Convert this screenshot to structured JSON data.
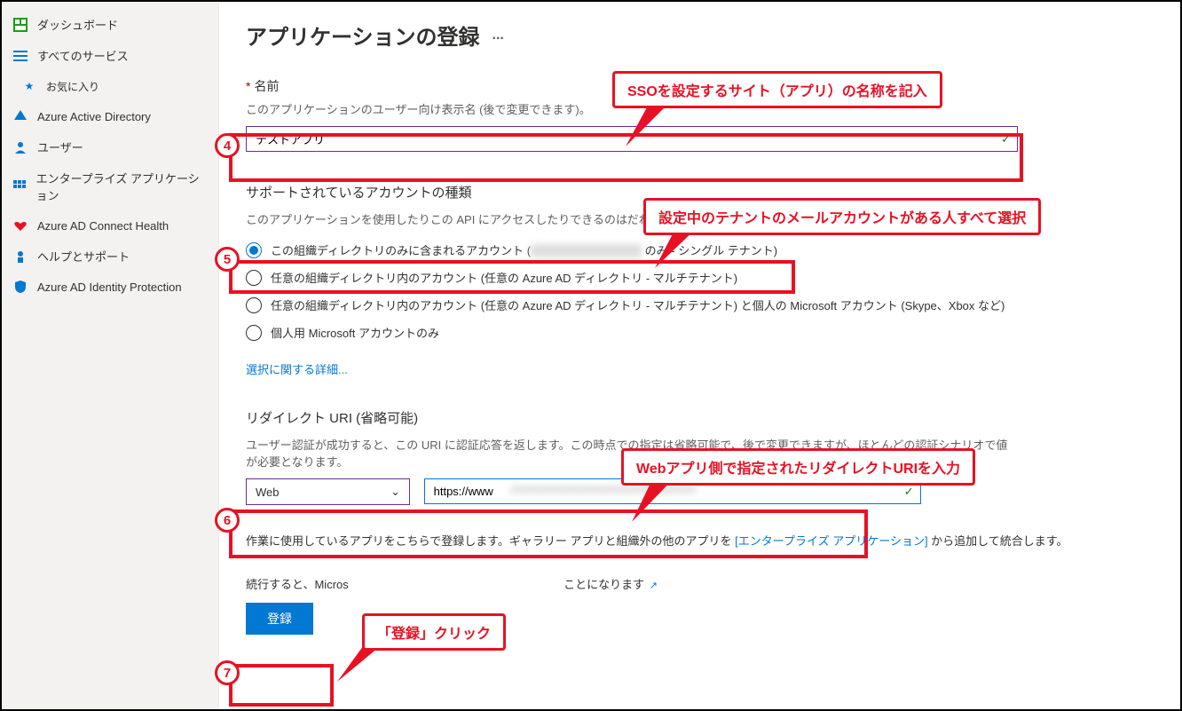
{
  "sidebar": {
    "items": [
      {
        "label": "ダッシュボード"
      },
      {
        "label": "すべてのサービス"
      },
      {
        "label": "お気に入り"
      },
      {
        "label": "Azure Active Directory"
      },
      {
        "label": "ユーザー"
      },
      {
        "label": "エンタープライズ アプリケーション"
      },
      {
        "label": "Azure AD Connect Health"
      },
      {
        "label": "ヘルプとサポート"
      },
      {
        "label": "Azure AD Identity Protection"
      }
    ]
  },
  "page": {
    "title": "アプリケーションの登録",
    "ellipsis": "..."
  },
  "nameSection": {
    "label": "名前",
    "desc": "このアプリケーションのユーザー向け表示名 (後で変更できます)。",
    "value": "テストアプリ"
  },
  "accountSection": {
    "label": "サポートされているアカウントの種類",
    "desc": "このアプリケーションを使用したりこの API にアクセスしたりできるのはだれですか?",
    "options": [
      "この組織ディレクトリのみに含まれるアカウント (",
      "任意の組織ディレクトリ内のアカウント (任意の Azure AD ディレクトリ - マルチテナント)",
      "任意の組織ディレクトリ内のアカウント (任意の Azure AD ディレクトリ - マルチテナント) と個人の Microsoft アカウント (Skype、Xbox など)",
      "個人用 Microsoft アカウントのみ"
    ],
    "opt1_suffix": " のみ - シングル テナント)",
    "moreLink": "選択に関する詳細..."
  },
  "redirectSection": {
    "label": "リダイレクト URI (省略可能)",
    "desc": "ユーザー認証が成功すると、この URI に認証応答を返します。この時点での指定は省略可能で、後で変更できますが、ほとんどの認証シナリオで値が必要となります。",
    "platform": "Web",
    "uri": "https://www"
  },
  "footer": {
    "note1_pre": "作業に使用しているアプリをこちらで登録します。ギャラリー アプリと組織外の他のアプリを ",
    "note1_link": "[エンタープライズ アプリケーション]",
    "note1_post": " から追加して統合します。",
    "note2_pre": "続行すると、Micros",
    "note2_post": "ことになります ",
    "registerBtn": "登録"
  },
  "callouts": {
    "c4": "SSOを設定するサイト（アプリ）の名称を記入",
    "c5": "設定中のテナントのメールアカウントがある人すべて選択",
    "c6": "Webアプリ側で指定されたリダイレクトURIを入力",
    "c7": "「登録」クリック"
  },
  "steps": {
    "s4": "4",
    "s5": "5",
    "s6": "6",
    "s7": "7"
  }
}
